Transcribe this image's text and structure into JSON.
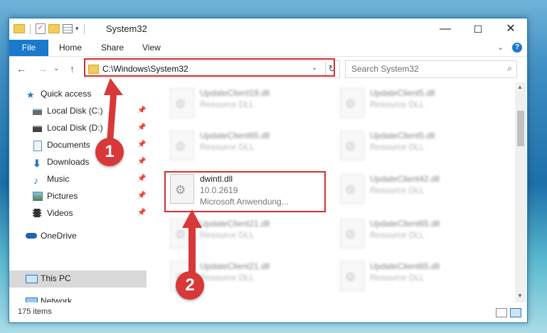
{
  "window": {
    "title": "System32",
    "min": "—",
    "max": "☐",
    "close": "✕"
  },
  "ribbon": {
    "file": "File",
    "tabs": [
      "Home",
      "Share",
      "View"
    ],
    "expand": "⌄",
    "help": "?"
  },
  "nav": {
    "back": "←",
    "forward": "→",
    "recent": "⌄",
    "up": "↑",
    "address": "C:\\Windows\\System32",
    "search_placeholder": "Search System32"
  },
  "sidebar": {
    "items": [
      {
        "label": "Quick access",
        "icon": "star-icon",
        "pinned": false
      },
      {
        "label": "Local Disk (C:)",
        "icon": "drive-icon",
        "pinned": true
      },
      {
        "label": "Local Disk (D:)",
        "icon": "drive-icon",
        "pinned": true
      },
      {
        "label": "Documents",
        "icon": "documents-icon",
        "pinned": true
      },
      {
        "label": "Downloads",
        "icon": "download-icon",
        "pinned": true
      },
      {
        "label": "Music",
        "icon": "music-icon",
        "pinned": true
      },
      {
        "label": "Pictures",
        "icon": "pictures-icon",
        "pinned": true
      },
      {
        "label": "Videos",
        "icon": "videos-icon",
        "pinned": true
      },
      {
        "label": "OneDrive",
        "icon": "cloud-icon",
        "pinned": false
      },
      {
        "label": "This PC",
        "icon": "computer-icon",
        "pinned": false
      },
      {
        "label": "Network",
        "icon": "network-icon",
        "pinned": false
      }
    ]
  },
  "files": [
    {
      "name": "UpdateClient19.dll",
      "sub": "Resource DLL"
    },
    {
      "name": "UpdateClient5.dll",
      "sub": "Resource DLL"
    },
    {
      "name": "UpdateClient65.dll",
      "sub": "Resource DLL"
    },
    {
      "name": "UpdateClient5.dll",
      "sub": "Resource DLL"
    },
    {
      "name": "dwintl.dll",
      "sub": "10.0.2619",
      "sub2": "Microsoft Anwendung..."
    },
    {
      "name": "UpdateClient42.dll",
      "sub": "Resource DLL"
    },
    {
      "name": "UpdateClient21.dll",
      "sub": "Resource DLL"
    },
    {
      "name": "UpdateClient65.dll",
      "sub": "Resource DLL"
    },
    {
      "name": "UpdateClient21.dll",
      "sub": "Resource DLL"
    },
    {
      "name": "UpdateClient65.dll",
      "sub": "Resource DLL"
    }
  ],
  "status": {
    "count": "175 items"
  },
  "annotations": {
    "step1": "1",
    "step2": "2",
    "color": "#d83838"
  }
}
